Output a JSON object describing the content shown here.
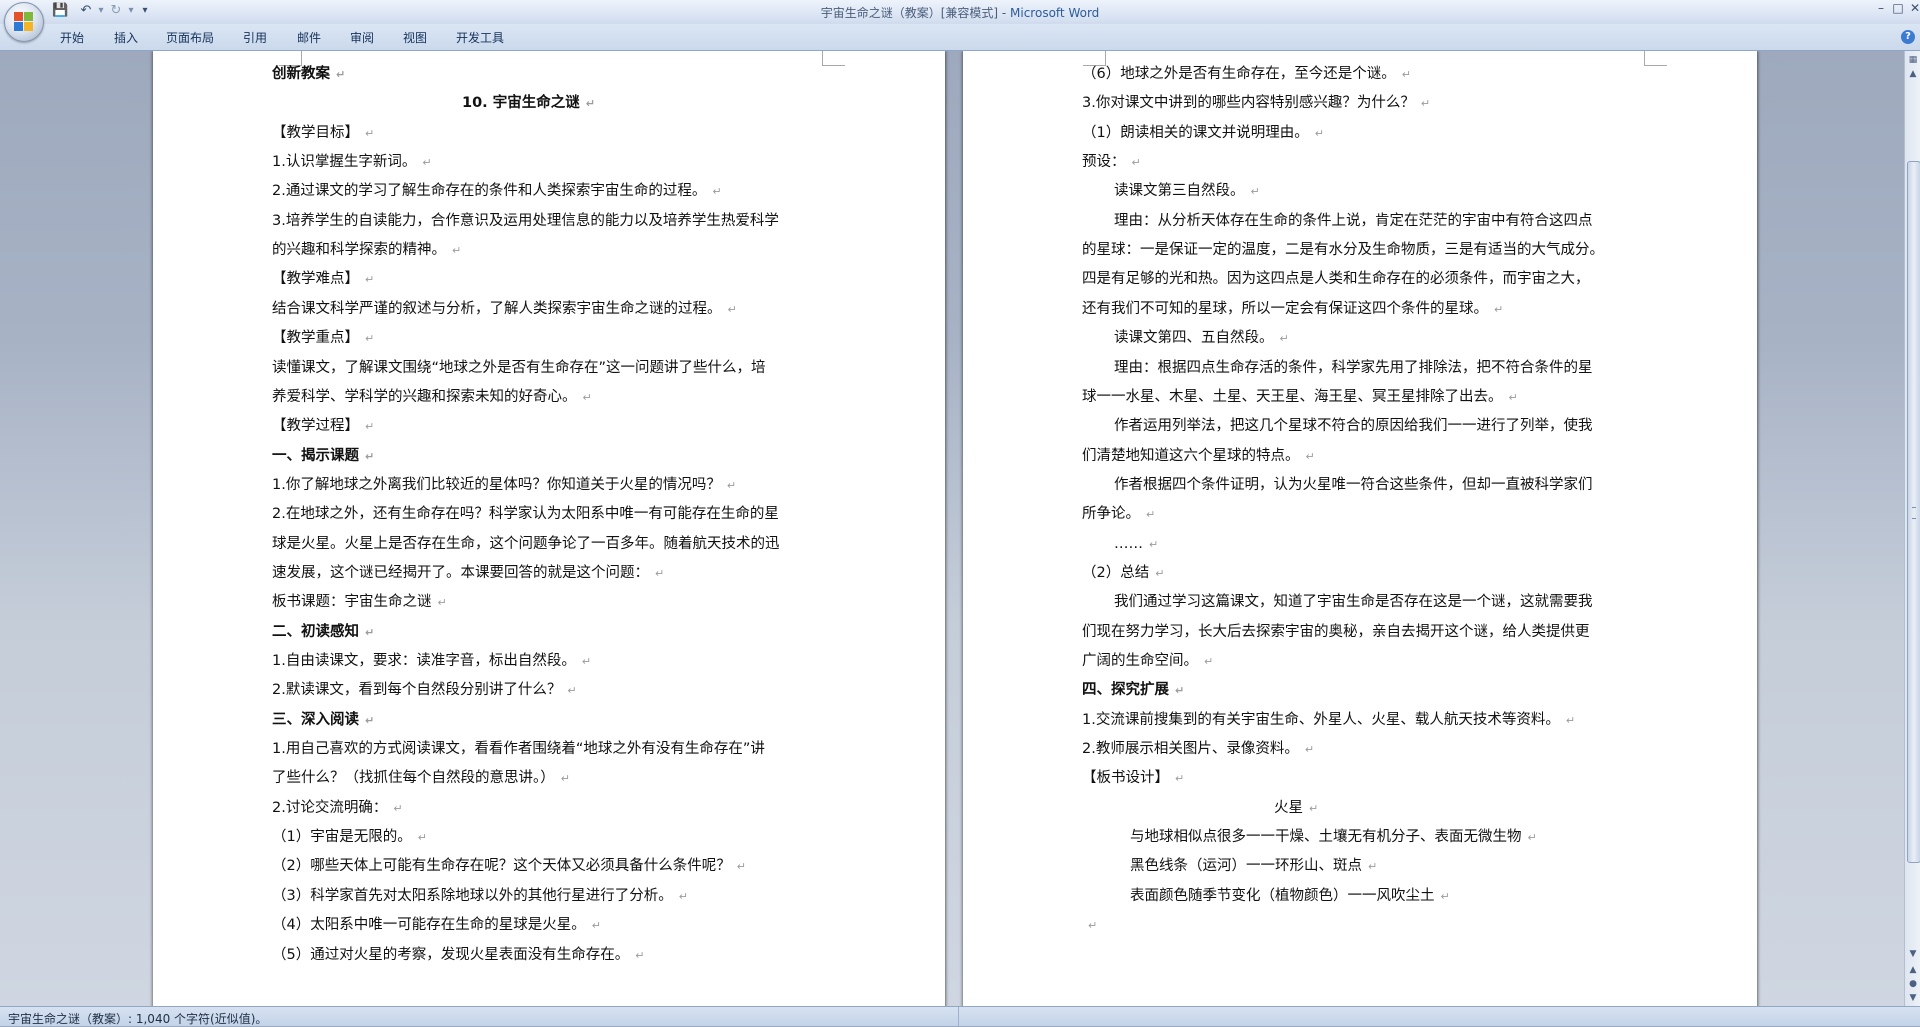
{
  "window": {
    "title_doc": "宇宙生命之谜（教案）[兼容模式] - ",
    "title_app": "Microsoft Word"
  },
  "quick_access": {
    "save_icon": "floppy-disk-icon",
    "undo_icon": "undo-arrow-icon",
    "redo_icon": "redo-arrow-icon",
    "customize_icon": "dropdown-caret-icon"
  },
  "ribbon": {
    "tabs": [
      "开始",
      "插入",
      "页面布局",
      "引用",
      "邮件",
      "审阅",
      "视图",
      "开发工具"
    ]
  },
  "left_page": {
    "lines": [
      {
        "text": "创新教案",
        "bold": true,
        "indent": 0
      },
      {
        "text": "10. 宇宙生命之谜",
        "bold": true,
        "indent": 190
      },
      {
        "text": "【教学目标】",
        "bold": false,
        "indent": 0
      },
      {
        "text": "1.认识掌握生字新词。",
        "bold": false,
        "indent": 0
      },
      {
        "text": "2.通过课文的学习了解生命存在的条件和人类探索宇宙生命的过程。",
        "bold": false,
        "indent": 0
      },
      {
        "text": "3.培养学生的自读能力，合作意识及运用处理信息的能力以及培养学生热爱科学",
        "bold": false,
        "indent": 0,
        "nomark": true
      },
      {
        "text": "的兴趣和科学探索的精神。",
        "bold": false,
        "indent": 0
      },
      {
        "text": "【教学难点】",
        "bold": false,
        "indent": 0
      },
      {
        "text": "结合课文科学严谨的叙述与分析，了解人类探索宇宙生命之谜的过程。",
        "bold": false,
        "indent": 0
      },
      {
        "text": "【教学重点】",
        "bold": false,
        "indent": 0
      },
      {
        "text": "读懂课文，了解课文围绕“地球之外是否有生命存在”这一问题讲了些什么，培",
        "bold": false,
        "indent": 0,
        "nomark": true
      },
      {
        "text": "养爱科学、学科学的兴趣和探索未知的好奇心。",
        "bold": false,
        "indent": 0
      },
      {
        "text": "【教学过程】",
        "bold": false,
        "indent": 0
      },
      {
        "text": "一、揭示课题",
        "bold": true,
        "indent": 0
      },
      {
        "text": "1.你了解地球之外离我们比较近的星体吗？你知道关于火星的情况吗？",
        "bold": false,
        "indent": 0
      },
      {
        "text": "2.在地球之外，还有生命存在吗？科学家认为太阳系中唯一有可能存在生命的星",
        "bold": false,
        "indent": 0,
        "nomark": true
      },
      {
        "text": "球是火星。火星上是否存在生命，这个问题争论了一百多年。随着航天技术的迅",
        "bold": false,
        "indent": 0,
        "nomark": true
      },
      {
        "text": "速发展，这个谜已经揭开了。本课要回答的就是这个问题：",
        "bold": false,
        "indent": 0
      },
      {
        "text": "板书课题：宇宙生命之谜",
        "bold": false,
        "indent": 0
      },
      {
        "text": "二、初读感知",
        "bold": true,
        "indent": 0
      },
      {
        "text": "1.自由读课文，要求：读准字音，标出自然段。",
        "bold": false,
        "indent": 0
      },
      {
        "text": "2.默读课文，看到每个自然段分别讲了什么？",
        "bold": false,
        "indent": 0
      },
      {
        "text": "三、深入阅读",
        "bold": true,
        "indent": 0
      },
      {
        "text": "1.用自己喜欢的方式阅读课文，看看作者围绕着“地球之外有没有生命存在”讲",
        "bold": false,
        "indent": 0,
        "nomark": true
      },
      {
        "text": "了些什么？（找抓住每个自然段的意思讲。）",
        "bold": false,
        "indent": 0
      },
      {
        "text": "2.讨论交流明确：",
        "bold": false,
        "indent": 0
      },
      {
        "text": "（1）宇宙是无限的。",
        "bold": false,
        "indent": 0
      },
      {
        "text": "（2）哪些天体上可能有生命存在呢？这个天体又必须具备什么条件呢？",
        "bold": false,
        "indent": 0
      },
      {
        "text": "（3）科学家首先对太阳系除地球以外的其他行星进行了分析。",
        "bold": false,
        "indent": 0
      },
      {
        "text": "（4）太阳系中唯一可能存在生命的星球是火星。",
        "bold": false,
        "indent": 0
      },
      {
        "text": "（5）通过对火星的考察，发现火星表面没有生命存在。",
        "bold": false,
        "indent": 0
      }
    ]
  },
  "right_page": {
    "lines": [
      {
        "text": "（6）地球之外是否有生命存在，至今还是个谜。",
        "bold": false,
        "indent": 0
      },
      {
        "text": "3.你对课文中讲到的哪些内容特别感兴趣？为什么？",
        "bold": false,
        "indent": 0
      },
      {
        "text": "（1）朗读相关的课文并说明理由。",
        "bold": false,
        "indent": 0
      },
      {
        "text": "预设：",
        "bold": false,
        "indent": 0
      },
      {
        "text": "读课文第三自然段。",
        "bold": false,
        "indent": 32
      },
      {
        "text": "理由：从分析天体存在生命的条件上说，肯定在茫茫的宇宙中有符合这四点",
        "bold": false,
        "indent": 32,
        "nomark": true
      },
      {
        "text": "的星球：一是保证一定的温度，二是有水分及生命物质，三是有适当的大气成分。",
        "bold": false,
        "indent": 0,
        "nomark": true
      },
      {
        "text": "四是有足够的光和热。因为这四点是人类和生命存在的必须条件，而宇宙之大，",
        "bold": false,
        "indent": 0,
        "nomark": true
      },
      {
        "text": "还有我们不可知的星球，所以一定会有保证这四个条件的星球。",
        "bold": false,
        "indent": 0
      },
      {
        "text": "读课文第四、五自然段。",
        "bold": false,
        "indent": 32
      },
      {
        "text": "理由：根据四点生命存活的条件，科学家先用了排除法，把不符合条件的星",
        "bold": false,
        "indent": 32,
        "nomark": true
      },
      {
        "text": "球一一水星、木星、土星、天王星、海王星、冥王星排除了出去。",
        "bold": false,
        "indent": 0
      },
      {
        "text": "作者运用列举法，把这几个星球不符合的原因给我们一一进行了列举，使我",
        "bold": false,
        "indent": 32,
        "nomark": true
      },
      {
        "text": "们清楚地知道这六个星球的特点。",
        "bold": false,
        "indent": 0
      },
      {
        "text": "作者根据四个条件证明，认为火星唯一符合这些条件，但却一直被科学家们",
        "bold": false,
        "indent": 32,
        "nomark": true
      },
      {
        "text": "所争论。",
        "bold": false,
        "indent": 0
      },
      {
        "text": "……",
        "bold": false,
        "indent": 32
      },
      {
        "text": "（2）总结",
        "bold": false,
        "indent": 0
      },
      {
        "text": "我们通过学习这篇课文，知道了宇宙生命是否存在这是一个谜，这就需要我",
        "bold": false,
        "indent": 32,
        "nomark": true
      },
      {
        "text": "们现在努力学习，长大后去探索宇宙的奥秘，亲自去揭开这个谜，给人类提供更",
        "bold": false,
        "indent": 0,
        "nomark": true
      },
      {
        "text": "广阔的生命空间。",
        "bold": false,
        "indent": 0
      },
      {
        "text": "四、探究扩展",
        "bold": true,
        "indent": 0
      },
      {
        "text": "1.交流课前搜集到的有关宇宙生命、外星人、火星、载人航天技术等资料。",
        "bold": false,
        "indent": 0
      },
      {
        "text": "2.教师展示相关图片、录像资料。",
        "bold": false,
        "indent": 0
      },
      {
        "text": "【板书设计】",
        "bold": false,
        "indent": 0
      },
      {
        "text": "火星",
        "bold": false,
        "indent": 192
      },
      {
        "text": "与地球相似点很多一一干燥、土壤无有机分子、表面无微生物",
        "bold": false,
        "indent": 48
      },
      {
        "text": "黑色线条（运河）一一环形山、斑点",
        "bold": false,
        "indent": 48
      },
      {
        "text": "表面颜色随季节变化（植物颜色）一一风吹尘土",
        "bold": false,
        "indent": 48
      },
      {
        "text": "",
        "bold": false,
        "indent": 0
      }
    ]
  },
  "status_bar": {
    "text": "宇宙生命之谜（教案）: 1,040 个字符(近似值)。"
  },
  "paragraph_mark": "↵",
  "colors": {
    "title_app": "#2d5b9c",
    "page": "#ffffff",
    "workspace": "#a7b2c5"
  }
}
